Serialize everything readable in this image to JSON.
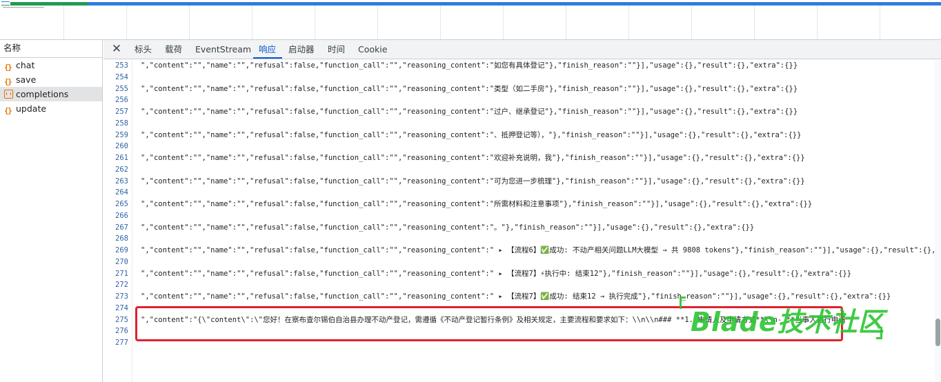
{
  "request_list": {
    "header": "名称",
    "items": [
      {
        "name": "chat",
        "icon": "json-icon",
        "selected": false
      },
      {
        "name": "save",
        "icon": "json-icon",
        "selected": false
      },
      {
        "name": "completions",
        "icon": "document-icon",
        "selected": true
      },
      {
        "name": "update",
        "icon": "json-icon",
        "selected": false
      }
    ]
  },
  "tabs": [
    {
      "label": "标头",
      "active": false
    },
    {
      "label": "载荷",
      "active": false
    },
    {
      "label": "EventStream",
      "active": false
    },
    {
      "label": "响应",
      "active": true
    },
    {
      "label": "启动器",
      "active": false
    },
    {
      "label": "时间",
      "active": false
    },
    {
      "label": "Cookie",
      "active": false
    }
  ],
  "close_icon": "close-icon",
  "lines": [
    {
      "num": "253",
      "text": "\",\"content\":\"\",\"name\":\"\",\"refusal\":false,\"function_call\":\"\",\"reasoning_content\":\"如您有具体登记\"},\"finish_reason\":\"\"}],\"usage\":{},\"result\":{},\"extra\":{}}"
    },
    {
      "num": "254",
      "text": ""
    },
    {
      "num": "255",
      "text": "\",\"content\":\"\",\"name\":\"\",\"refusal\":false,\"function_call\":\"\",\"reasoning_content\":\"类型（如二手房\"},\"finish_reason\":\"\"}],\"usage\":{},\"result\":{},\"extra\":{}}"
    },
    {
      "num": "256",
      "text": ""
    },
    {
      "num": "257",
      "text": "\",\"content\":\"\",\"name\":\"\",\"refusal\":false,\"function_call\":\"\",\"reasoning_content\":\"过户、继承登记\"},\"finish_reason\":\"\"}],\"usage\":{},\"result\":{},\"extra\":{}}"
    },
    {
      "num": "258",
      "text": ""
    },
    {
      "num": "259",
      "text": "\",\"content\":\"\",\"name\":\"\",\"refusal\":false,\"function_call\":\"\",\"reasoning_content\":\"、抵押登记等），\"},\"finish_reason\":\"\"}],\"usage\":{},\"result\":{},\"extra\":{}}"
    },
    {
      "num": "260",
      "text": ""
    },
    {
      "num": "261",
      "text": "\",\"content\":\"\",\"name\":\"\",\"refusal\":false,\"function_call\":\"\",\"reasoning_content\":\"欢迎补充说明，我\"},\"finish_reason\":\"\"}],\"usage\":{},\"result\":{},\"extra\":{}}"
    },
    {
      "num": "262",
      "text": ""
    },
    {
      "num": "263",
      "text": "\",\"content\":\"\",\"name\":\"\",\"refusal\":false,\"function_call\":\"\",\"reasoning_content\":\"可为您进一步梳理\"},\"finish_reason\":\"\"}],\"usage\":{},\"result\":{},\"extra\":{}}"
    },
    {
      "num": "264",
      "text": ""
    },
    {
      "num": "265",
      "text": "\",\"content\":\"\",\"name\":\"\",\"refusal\":false,\"function_call\":\"\",\"reasoning_content\":\"所需材料和注意事项\"},\"finish_reason\":\"\"}],\"usage\":{},\"result\":{},\"extra\":{}}"
    },
    {
      "num": "266",
      "text": ""
    },
    {
      "num": "267",
      "text": "\",\"content\":\"\",\"name\":\"\",\"refusal\":false,\"function_call\":\"\",\"reasoning_content\":\"。\"},\"finish_reason\":\"\"}],\"usage\":{},\"result\":{},\"extra\":{}}"
    },
    {
      "num": "268",
      "text": ""
    },
    {
      "num": "269",
      "text": "\",\"content\":\"\",\"name\":\"\",\"refusal\":false,\"function_call\":\"\",\"reasoning_content\":\" ▸ 【流程6】✅成功: 不动产相关问题LLM大模型 → 共 9808 tokens\"},\"finish_reason\":\"\"}],\"usage\":{},\"result\":{},\""
    },
    {
      "num": "270",
      "text": ""
    },
    {
      "num": "271",
      "text": "\",\"content\":\"\",\"name\":\"\",\"refusal\":false,\"function_call\":\"\",\"reasoning_content\":\" ▸ 【流程7】⚡执行中: 结束12\"},\"finish_reason\":\"\"}],\"usage\":{},\"result\":{},\"extra\":{}}"
    },
    {
      "num": "272",
      "text": ""
    },
    {
      "num": "273",
      "text": "\",\"content\":\"\",\"name\":\"\",\"refusal\":false,\"function_call\":\"\",\"reasoning_content\":\" ▸ 【流程7】✅成功: 结束12 → 执行完成\"},\"finish_reason\":\"\"}],\"usage\":{},\"result\":{},\"extra\":{}}"
    },
    {
      "num": "274",
      "text": ""
    },
    {
      "num": "275",
      "text": "\",\"content\":\"{\\\"content\\\":\\\"您好！在察布查尔锡伯自治县办理不动产登记，需遵循《不动产登记暂行条例》及相关规定，主要流程和要求如下：\\\\n\\\\n### **1. 申请人及申请方式**\\\\n- **当事人自行申请"
    },
    {
      "num": "276",
      "text": ""
    },
    {
      "num": "277",
      "text": ""
    }
  ],
  "watermark": "Blade技术社区",
  "colors": {
    "accent": "#0b57d0",
    "line_number": "#2f63a5",
    "highlight_box": "#e0202f",
    "watermark": "#27c32e",
    "timeline_green": "#1f9c50",
    "timeline_blue": "#2f7de1"
  }
}
